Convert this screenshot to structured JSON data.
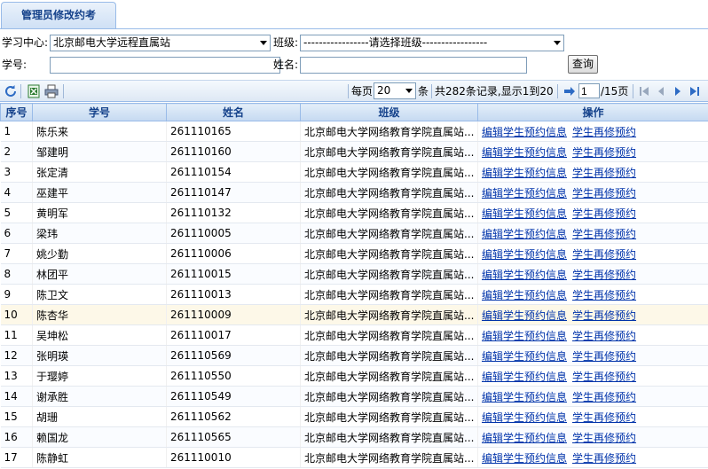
{
  "tab": {
    "title": "管理员修改约考"
  },
  "form": {
    "center_label": "学习中心:",
    "center_value": "北京邮电大学远程直属站",
    "class_label": "班级:",
    "class_value": "-----------------请选择班级-----------------",
    "student_no_label": "学号:",
    "student_no_value": "",
    "name_label": "姓名:",
    "name_value": "",
    "search_button": "查询"
  },
  "toolbar": {
    "refresh_icon": "refresh-icon",
    "export_icon": "excel-export-icon",
    "print_icon": "print-icon",
    "per_page_prefix": "每页",
    "per_page_value": "20",
    "per_page_suffix": "条",
    "summary": "共282条记录,显示1到20",
    "go_icon": "go-arrow-icon",
    "current_page": "1",
    "total_pages": "/15页"
  },
  "table": {
    "headers": [
      "序号",
      "学号",
      "姓名",
      "班级",
      "操作"
    ],
    "rows": [
      {
        "seq": "1",
        "name": "陈乐来",
        "no": "261110165",
        "cls": "北京邮电大学网络教育学院直属站..."
      },
      {
        "seq": "2",
        "name": "邹建明",
        "no": "261110160",
        "cls": "北京邮电大学网络教育学院直属站..."
      },
      {
        "seq": "3",
        "name": "张定清",
        "no": "261110154",
        "cls": "北京邮电大学网络教育学院直属站..."
      },
      {
        "seq": "4",
        "name": "巫建平",
        "no": "261110147",
        "cls": "北京邮电大学网络教育学院直属站..."
      },
      {
        "seq": "5",
        "name": "黄明军",
        "no": "261110132",
        "cls": "北京邮电大学网络教育学院直属站..."
      },
      {
        "seq": "6",
        "name": "梁玮",
        "no": "261110005",
        "cls": "北京邮电大学网络教育学院直属站..."
      },
      {
        "seq": "7",
        "name": "姚少勤",
        "no": "261110006",
        "cls": "北京邮电大学网络教育学院直属站..."
      },
      {
        "seq": "8",
        "name": "林团平",
        "no": "261110015",
        "cls": "北京邮电大学网络教育学院直属站..."
      },
      {
        "seq": "9",
        "name": "陈卫文",
        "no": "261110013",
        "cls": "北京邮电大学网络教育学院直属站..."
      },
      {
        "seq": "10",
        "name": "陈杏华",
        "no": "261110009",
        "cls": "北京邮电大学网络教育学院直属站..."
      },
      {
        "seq": "11",
        "name": "吴坤松",
        "no": "261110017",
        "cls": "北京邮电大学网络教育学院直属站..."
      },
      {
        "seq": "12",
        "name": "张明瑛",
        "no": "261110569",
        "cls": "北京邮电大学网络教育学院直属站..."
      },
      {
        "seq": "13",
        "name": "于璎婷",
        "no": "261110550",
        "cls": "北京邮电大学网络教育学院直属站..."
      },
      {
        "seq": "14",
        "name": "谢承胜",
        "no": "261110549",
        "cls": "北京邮电大学网络教育学院直属站..."
      },
      {
        "seq": "15",
        "name": "胡珊",
        "no": "261110562",
        "cls": "北京邮电大学网络教育学院直属站..."
      },
      {
        "seq": "16",
        "name": "赖国龙",
        "no": "261110565",
        "cls": "北京邮电大学网络教育学院直属站..."
      },
      {
        "seq": "17",
        "name": "陈静虹",
        "no": "261110010",
        "cls": "北京邮电大学网络教育学院直属站..."
      }
    ],
    "action_edit": "编辑学生预约信息",
    "action_retake": "学生再修预约"
  },
  "colors": {
    "header_text": "#15428b",
    "link": "#0033aa",
    "border": "#99bbe8"
  }
}
